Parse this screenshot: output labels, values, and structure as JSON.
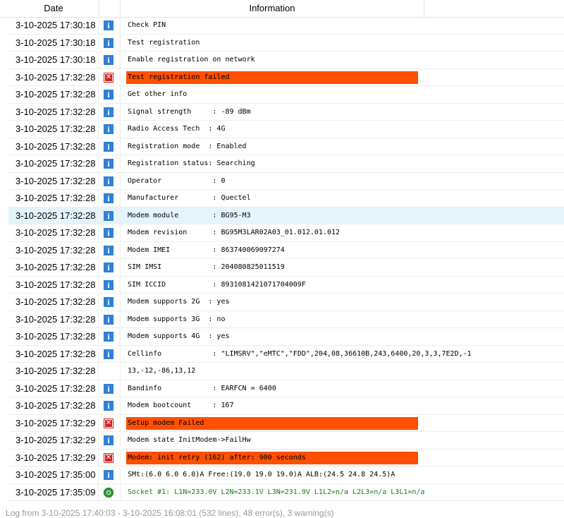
{
  "header": {
    "date": "Date",
    "information": "Information"
  },
  "rows": [
    {
      "date": "3-10-2025 17:30:18",
      "icon": "info-icon",
      "text": "Check PIN"
    },
    {
      "date": "3-10-2025 17:30:18",
      "icon": "info-icon",
      "text": "Test registration"
    },
    {
      "date": "3-10-2025 17:30:18",
      "icon": "info-icon",
      "text": "Enable registration on network"
    },
    {
      "date": "3-10-2025 17:32:28",
      "icon": "error-icon",
      "text": "Test registration failed"
    },
    {
      "date": "3-10-2025 17:32:28",
      "icon": "info-icon",
      "text": "Get other info"
    },
    {
      "date": "3-10-2025 17:32:28",
      "icon": "info-icon",
      "text": "Signal strength     : -89 dBm"
    },
    {
      "date": "3-10-2025 17:32:28",
      "icon": "info-icon",
      "text": "Radio Access Tech  : 4G"
    },
    {
      "date": "3-10-2025 17:32:28",
      "icon": "info-icon",
      "text": "Registration mode  : Enabled"
    },
    {
      "date": "3-10-2025 17:32:28",
      "icon": "info-icon",
      "text": "Registration status: Searching"
    },
    {
      "date": "3-10-2025 17:32:28",
      "icon": "info-icon",
      "text": "Operator            : 0"
    },
    {
      "date": "3-10-2025 17:32:28",
      "icon": "info-icon",
      "text": "Manufacturer        : Quectel"
    },
    {
      "date": "3-10-2025 17:32:28",
      "icon": "info-icon",
      "text": "Modem module        : BG95-M3",
      "selected": true
    },
    {
      "date": "3-10-2025 17:32:28",
      "icon": "info-icon",
      "text": "Modem revision      : BG95M3LAR02A03_01.012.01.012"
    },
    {
      "date": "3-10-2025 17:32:28",
      "icon": "info-icon",
      "text": "Modem IMEI          : 863740069097274"
    },
    {
      "date": "3-10-2025 17:32:28",
      "icon": "info-icon",
      "text": "SIM IMSI            : 204080825011519"
    },
    {
      "date": "3-10-2025 17:32:28",
      "icon": "info-icon",
      "text": "SIM ICCID           : 8931081421071704009F"
    },
    {
      "date": "3-10-2025 17:32:28",
      "icon": "info-icon",
      "text": "Modem supports 2G  : yes"
    },
    {
      "date": "3-10-2025 17:32:28",
      "icon": "info-icon",
      "text": "Modem supports 3G  : no"
    },
    {
      "date": "3-10-2025 17:32:28",
      "icon": "info-icon",
      "text": "Modem supports 4G  : yes"
    },
    {
      "date": "3-10-2025 17:32:28",
      "icon": "info-icon",
      "text": "Cellinfo            : \"LIMSRV\",\"eMTC\",\"FDD\",204,08,36610B,243,6400,20,3,3,7E2D,-1"
    },
    {
      "date": "3-10-2025 17:32:28",
      "icon": "none",
      "text": "13,-12,-86,13,12"
    },
    {
      "date": "3-10-2025 17:32:28",
      "icon": "info-icon",
      "text": "Bandinfo            : EARFCN = 6400"
    },
    {
      "date": "3-10-2025 17:32:28",
      "icon": "info-icon",
      "text": "Modem bootcount     : 167"
    },
    {
      "date": "3-10-2025 17:32:29",
      "icon": "error-icon",
      "text": "Setup modem Failed"
    },
    {
      "date": "3-10-2025 17:32:29",
      "icon": "info-icon",
      "text": "Modem state InitModem->FailHw"
    },
    {
      "date": "3-10-2025 17:32:29",
      "icon": "error-icon",
      "text": "Modem: init retry (162) after: 900 seconds"
    },
    {
      "date": "3-10-2025 17:35:00",
      "icon": "info-icon",
      "text": "SMt:(6.0 6.0 6.0)A Free:(19.0 19.0 19.0)A ALB:(24.5 24.8 24.5)A"
    },
    {
      "date": "3-10-2025 17:35:09",
      "icon": "socket-icon",
      "text": "Socket #1: L1N=233.0V L2N=233.1V L3N=231.9V L1L2=n/a L2L3=n/a L3L1=n/a"
    }
  ],
  "colors": {
    "error_bg": "#ff4f00",
    "info_icon": "#2f80d8",
    "error_icon": "#d32020",
    "socket_text": "#1a7a1a",
    "selected_row": "#e5f3fb"
  },
  "footer": {
    "status": "Log from 3-10-2025 17:40:03 - 3-10-2025 16:08:01 (532 lines), 48 error(s), 3 warning(s)"
  }
}
